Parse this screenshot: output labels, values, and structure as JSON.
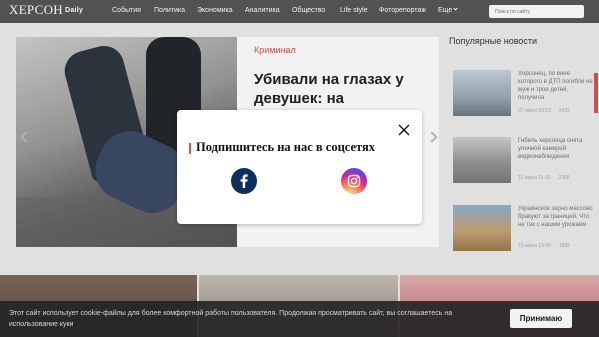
{
  "header": {
    "logo_main": "ХЕРСОН",
    "logo_sub": "Daily",
    "nav": [
      "События",
      "Политика",
      "Экономика",
      "Аналитика",
      "Общество",
      "Life style",
      "Фоторепортаж",
      "Еще"
    ],
    "search_placeholder": "Поиск по сайту"
  },
  "hero": {
    "category": "Криминал",
    "headline": "Убивали на глазах у девушек: на Херсонщине"
  },
  "popular": {
    "title": "Популярные новости",
    "items": [
      {
        "text": "Херсонец, по вине которого в ДТП погибли ее муж и трое детей, получила",
        "date": "07 июня 10:53",
        "views": "2425",
        "thumb_color": "#b9c7d3"
      },
      {
        "text": "Гибель херсонца снята уличной камерой видеонаблюдения",
        "date": "15 июня 11:15",
        "views": "2388",
        "thumb_color": "#a8a8a8"
      },
      {
        "text": "Украинское зерно массово бракуют за границей. Что не так с нашим урожаем",
        "date": "15 июня 13:49",
        "views": "1885",
        "thumb_color": "#c89f6e"
      }
    ]
  },
  "modal": {
    "title": "Подпишитесь на нас в соцсетях",
    "facebook_icon": "facebook-icon",
    "instagram_icon": "instagram-icon"
  },
  "cookie": {
    "text": "Этот сайт использует cookie-файлы для более комфортной работы пользователя. Продолжая просматривать сайт, вы соглашаетесь на использование куки",
    "button": "Принимаю"
  },
  "colors": {
    "accent": "#d9534f",
    "topbar": "#575757",
    "facebook": "#0c2f5c"
  }
}
